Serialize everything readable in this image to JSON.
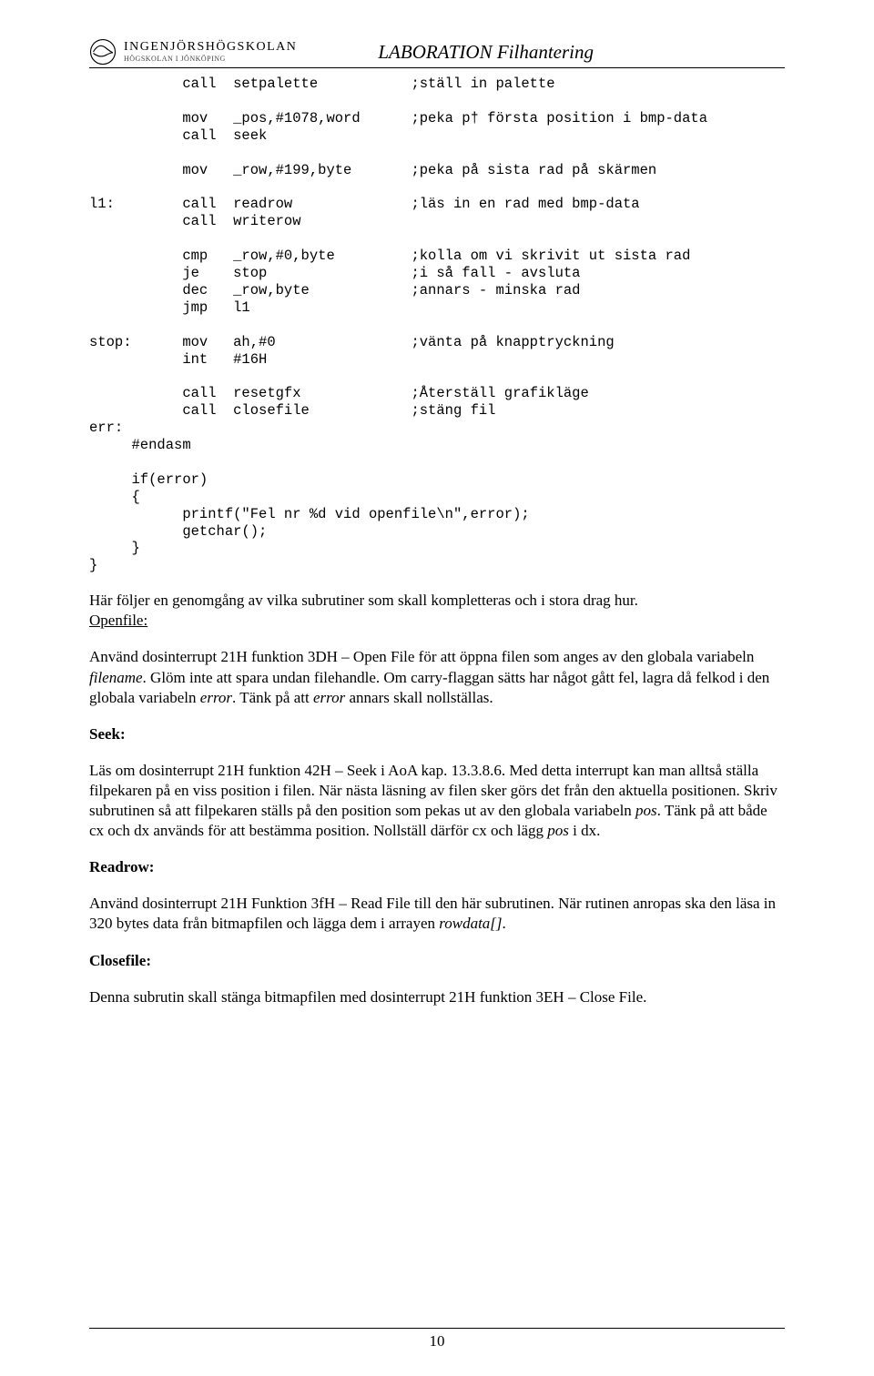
{
  "header": {
    "school_top": "INGENJÖRSHÖGSKOLAN",
    "school_sub": "HÖGSKOLAN I JÖNKÖPING",
    "title": "LABORATION Filhantering"
  },
  "code_block": "           call  setpalette           ;ställ in palette\n\n           mov   _pos,#1078,word      ;peka p† första position i bmp-data\n           call  seek\n\n           mov   _row,#199,byte       ;peka på sista rad på skärmen\n\nl1:        call  readrow              ;läs in en rad med bmp-data\n           call  writerow\n\n           cmp   _row,#0,byte         ;kolla om vi skrivit ut sista rad\n           je    stop                 ;i så fall - avsluta\n           dec   _row,byte            ;annars - minska rad\n           jmp   l1\n\nstop:      mov   ah,#0                ;vänta på knapptryckning\n           int   #16H\n\n           call  resetgfx             ;Återställ grafikläge\n           call  closefile            ;stäng fil\nerr:\n     #endasm\n\n     if(error)\n     {\n           printf(\"Fel nr %d vid openfile\\n\",error);\n           getchar();\n     }\n}",
  "intro": {
    "text": "Här följer en genomgång av vilka subrutiner som skall kompletteras och i stora drag hur."
  },
  "openfile": {
    "label": "Openfile:",
    "p1a": "Använd dosinterrupt 21H funktion 3DH – Open File för att öppna filen som anges av den globala variabeln ",
    "p1_var1": "filename",
    "p1b": ". Glöm inte att spara undan filehandle. Om carry-flaggan sätts har något gått fel, lagra då felkod i den globala variabeln ",
    "p1_var2": "error",
    "p1c": ". Tänk på att ",
    "p1_var3": "error",
    "p1d": " annars skall nollställas."
  },
  "seek": {
    "label": "Seek:",
    "p1a": "Läs om dosinterrupt 21H funktion 42H – Seek i AoA kap. 13.3.8.6.  Med detta interrupt kan man alltså ställa filpekaren på en viss position i filen. När nästa läsning av filen sker görs det från den aktuella positionen. Skriv subrutinen så att filpekaren ställs på den position som pekas ut av den globala variabeln ",
    "p1_var1": "pos",
    "p1b": ". Tänk på att både cx och dx används för att bestämma position. Nollställ därför cx och lägg ",
    "p1_var2": " pos ",
    "p1c": "i dx."
  },
  "readrow": {
    "label": "Readrow:",
    "p1a": "Använd dosinterrupt 21H Funktion 3fH – Read File till den här subrutinen. När rutinen anropas ska den läsa in 320 bytes data från bitmapfilen och lägga dem i arrayen ",
    "p1_var1": "rowdata[]",
    "p1b": "."
  },
  "closefile": {
    "label": "Closefile:",
    "p1": "Denna subrutin skall stänga bitmapfilen med dosinterrupt 21H funktion 3EH – Close File."
  },
  "page_number": "10"
}
